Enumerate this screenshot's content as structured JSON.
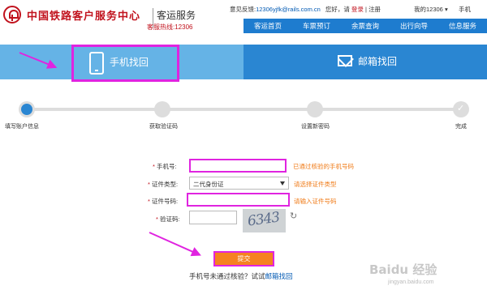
{
  "header": {
    "brand_title": "中国铁路客户服务中心",
    "brand_sub": "客运服务",
    "hotline": "客服热线:12306",
    "feedback_label": "意见反馈:",
    "feedback_email": "12306yjfk@rails.com.cn",
    "greeting": "您好，请",
    "login": "登录",
    "sep": "|",
    "register": "注册",
    "my12306": "我的12306 ▾",
    "mobile": "手机"
  },
  "nav": {
    "items": [
      "客运首页",
      "车票预订",
      "余票查询",
      "出行向导",
      "信息服务"
    ]
  },
  "tabs": {
    "phone": "手机找回",
    "email": "邮箱找回"
  },
  "steps": [
    "填写账户信息",
    "获取验证码",
    "设置新密码",
    "完成"
  ],
  "form": {
    "required_mark": "*",
    "phone_label": "手机号:",
    "phone_hint": "已通过核验的手机号码",
    "idtype_label": "证件类型:",
    "idtype_value": "二代身份证",
    "idtype_hint": "请选择证件类型",
    "idnum_label": "证件号码:",
    "idnum_hint": "请输入证件号码",
    "captcha_label": "验证码:",
    "captcha_text": "6343",
    "refresh_icon": "↻",
    "submit": "提交"
  },
  "footer": {
    "tip": "手机号未通过核验？试试",
    "link": "邮箱找回"
  },
  "watermark": {
    "main": "Baidu 经验",
    "sub": "jingyan.baidu.com"
  },
  "colors": {
    "brand_red": "#c1121d",
    "nav_blue": "#1e7ccf",
    "tab_light": "#65b3e6",
    "tab_dark": "#2a86d2",
    "highlight": "#e024e0",
    "submit_orange": "#f58220"
  }
}
